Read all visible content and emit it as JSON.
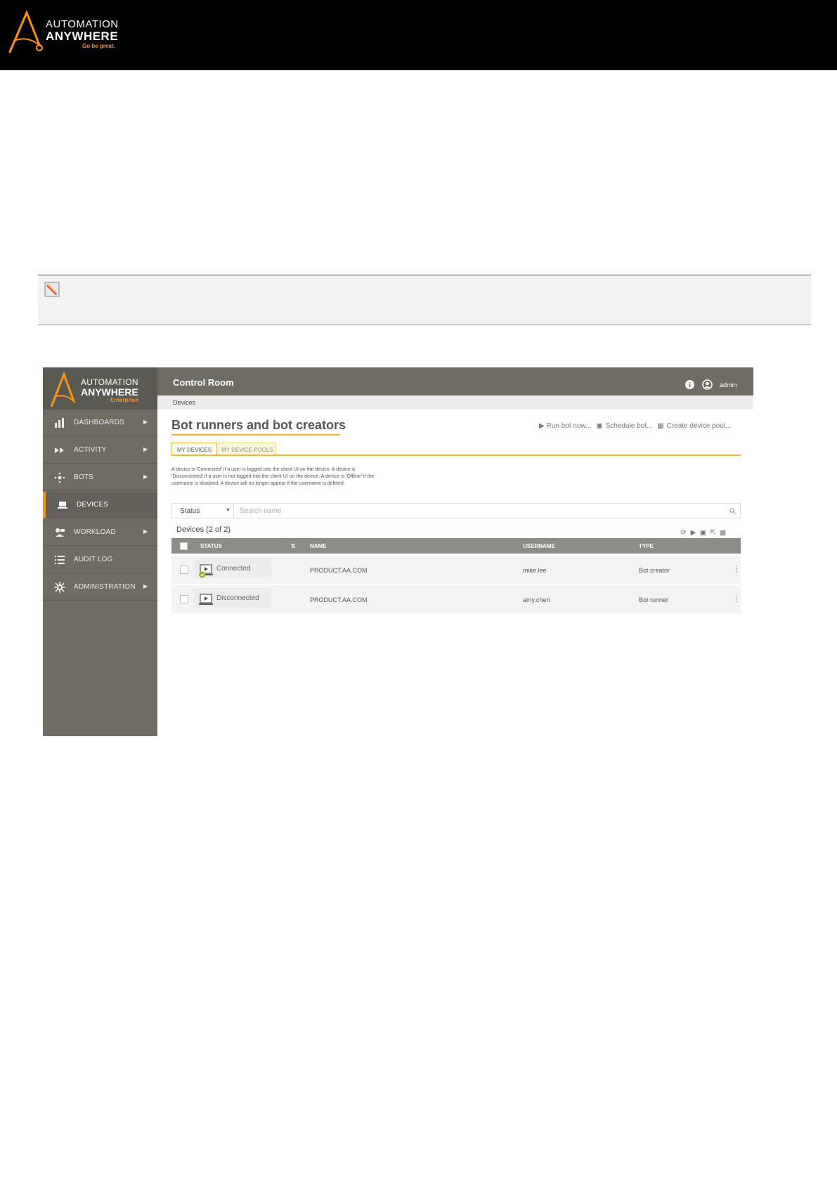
{
  "doc_header": {
    "logo_line1": "AUTOMATION",
    "logo_line2": "ANYWHERE",
    "logo_tagline": "Go be great.",
    "background": "#000000",
    "accent": "#f7941d"
  },
  "note_box": {
    "icon": "pencil-note-icon"
  },
  "app": {
    "logo_line1": "AUTOMATION",
    "logo_line2": "ANYWHERE",
    "logo_edition": "Enterprise",
    "top_title": "Control Room",
    "user_name": "admin",
    "breadcrumb": "Devices",
    "nav": [
      {
        "label": "DASHBOARDS",
        "icon": "dashboard-icon",
        "arrow": true
      },
      {
        "label": "ACTIVITY",
        "icon": "activity-icon",
        "arrow": true
      },
      {
        "label": "BOTS",
        "icon": "bots-icon",
        "arrow": true
      },
      {
        "label": "DEVICES",
        "icon": "laptop-icon",
        "arrow": false,
        "active": true
      },
      {
        "label": "WORKLOAD",
        "icon": "workload-icon",
        "arrow": true
      },
      {
        "label": "AUDIT LOG",
        "icon": "list-icon",
        "arrow": false
      },
      {
        "label": "ADMINISTRATION",
        "icon": "gear-icon",
        "arrow": true
      }
    ],
    "page_title": "Bot runners and bot creators",
    "actions": {
      "run": "▶ Run bot now...",
      "schedule": "Schedule bot...",
      "pool": "Create device pool..."
    },
    "tabs": [
      "MY DEVICES",
      "MY DEVICE POOLS"
    ],
    "description_lines": [
      "A device is 'Connected' if a user is logged into the client UI on the device. A device is",
      "'Disconnected' if a user is not logged into the client UI on the device. A device is 'Offline' if the",
      "username is disabled. A device will no longer appear if the username is deleted."
    ],
    "filter": {
      "status": "Status",
      "search_placeholder": "Search name"
    },
    "count_label": "Devices (2 of 2)",
    "table": {
      "columns": [
        "STATUS",
        "NAME",
        "USERNAME",
        "TYPE"
      ],
      "rows": [
        {
          "status": "Connected",
          "name": "PRODUCT.AA.COM",
          "username": "mike.lee",
          "type": "Bot creator"
        },
        {
          "status": "Disconnected",
          "name": "PRODUCT.AA.COM",
          "username": "amy.chen",
          "type": "Bot runner"
        }
      ]
    },
    "colors": {
      "sidebar": "#6e6c63",
      "accent": "#f5b233",
      "header_row": "#8d8c86"
    }
  }
}
